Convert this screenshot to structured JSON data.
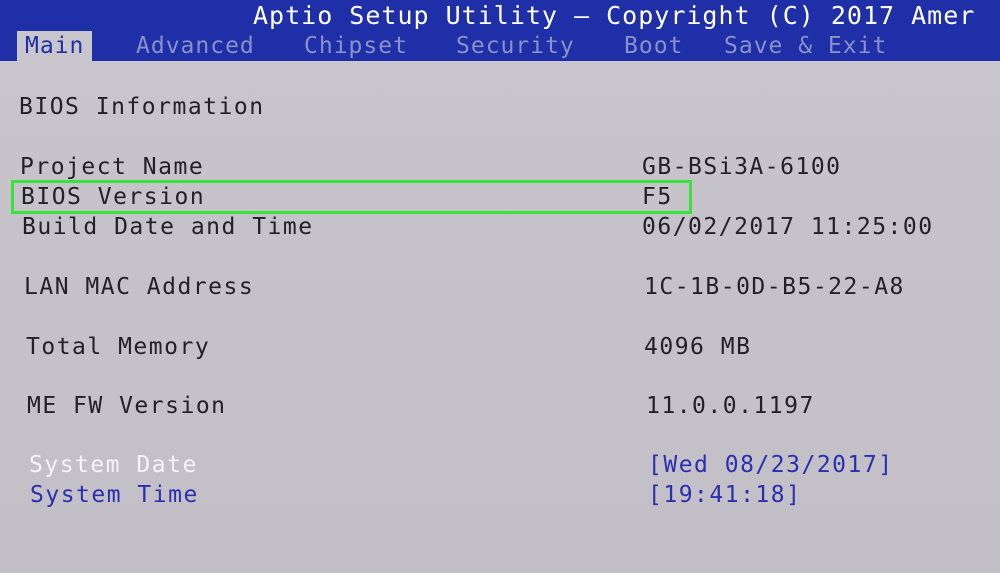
{
  "header": {
    "title": "Aptio Setup Utility – Copyright (C) 2017 Amer"
  },
  "tabs": [
    {
      "label": "Main",
      "active": true
    },
    {
      "label": "Advanced",
      "active": false
    },
    {
      "label": "Chipset",
      "active": false
    },
    {
      "label": "Security",
      "active": false
    },
    {
      "label": "Boot",
      "active": false
    },
    {
      "label": "Save & Exit",
      "active": false
    }
  ],
  "main": {
    "section_title": "BIOS Information",
    "rows": [
      {
        "label": "Project Name",
        "value": "GB-BSi3A-6100"
      },
      {
        "label": "BIOS Version",
        "value": "F5"
      },
      {
        "label": "Build Date and Time",
        "value": "06/02/2017 11:25:00"
      },
      {
        "label": "LAN MAC Address",
        "value": "1C-1B-0D-B5-22-A8"
      },
      {
        "label": "Total Memory",
        "value": "4096 MB"
      },
      {
        "label": "ME FW Version",
        "value": "11.0.0.1197"
      }
    ],
    "system_date": {
      "label": "System Date",
      "value": "[Wed 08/23/2017]"
    },
    "system_time": {
      "label": "System Time",
      "value": "[19:41:18]"
    }
  },
  "colors": {
    "header_bg": "#1f2fa8",
    "body_bg": "#c5c3c9",
    "editable_text": "#2a2fb0",
    "focus_text": "#f4f4f8",
    "highlight_box": "#39e43a"
  }
}
